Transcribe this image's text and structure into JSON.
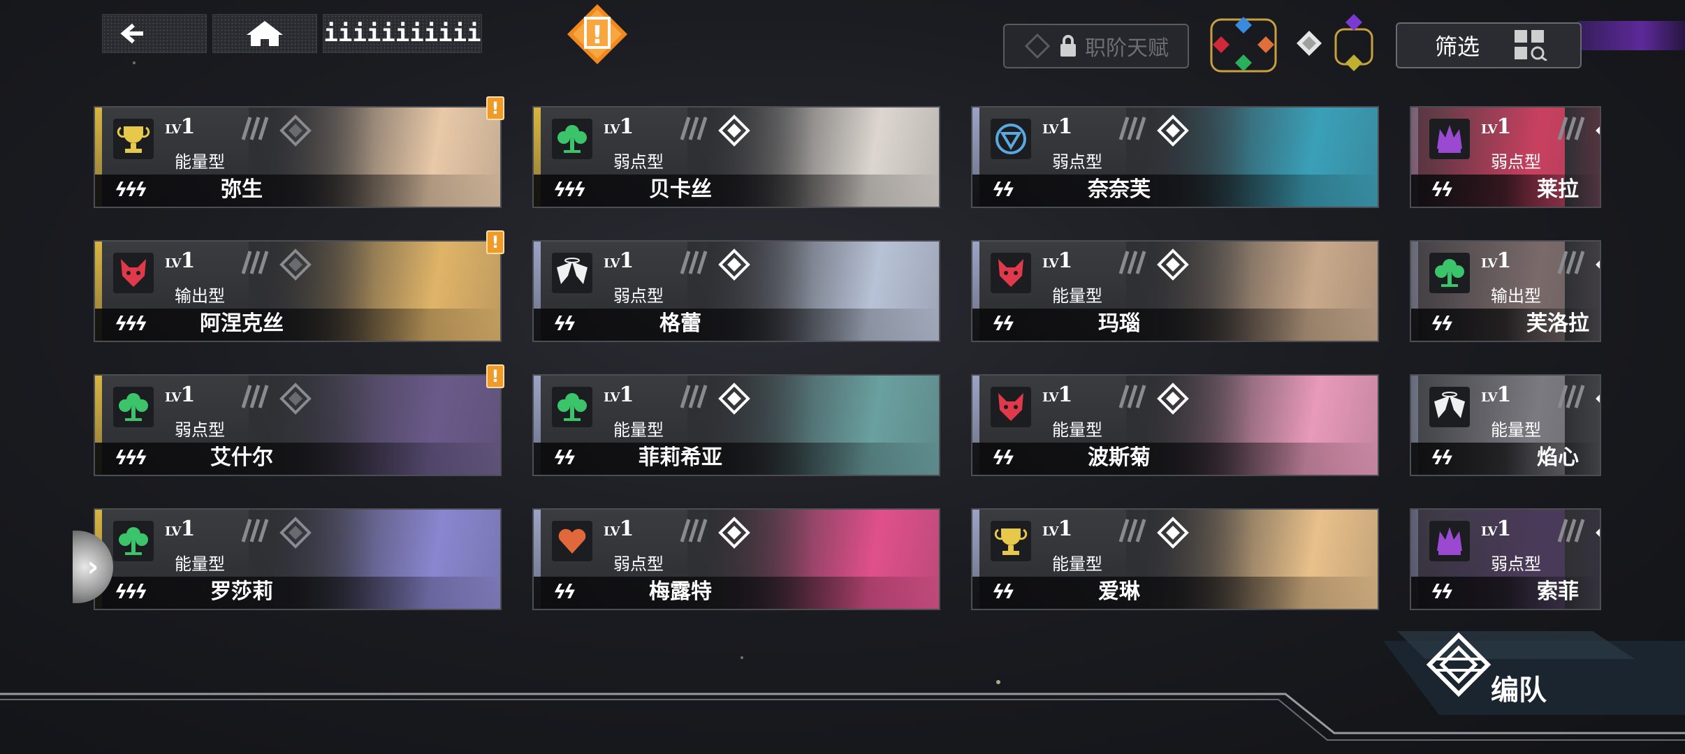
{
  "topbar": {
    "home_label": "",
    "page_tab_label": "iiiiiiiiiii",
    "alert_symbol": "!",
    "talent_label": "职阶天赋",
    "filter_label": "筛选",
    "back_icon": "back-arrow-icon",
    "home_icon": "home-icon"
  },
  "cards": [
    {
      "level_prefix": "LV",
      "level": "1",
      "type": "能量型",
      "name": "弥生",
      "color": "#d8b441",
      "icon": "trophy",
      "stars": "ⅉⅉⅉ",
      "bolts": "ϟϟϟ",
      "badge": "!",
      "portrait": "#e8c9a8"
    },
    {
      "level_prefix": "LV",
      "level": "1",
      "type": "弱点型",
      "name": "贝卡丝",
      "color": "#d8b441",
      "icon": "tree",
      "stars": "",
      "bolts": "ϟϟϟ",
      "badge": "",
      "portrait": "#dcd6cf"
    },
    {
      "level_prefix": "LV",
      "level": "1",
      "type": "弱点型",
      "name": "奈奈芙",
      "color": "#9aa3c4",
      "icon": "shield",
      "stars": "",
      "bolts": "ϟϟ",
      "badge": "",
      "portrait": "#3aa0b8"
    },
    {
      "level_prefix": "LV",
      "level": "1",
      "type": "弱点型",
      "name": "莱拉",
      "color": "#9aa3c4",
      "icon": "crown",
      "stars": "",
      "bolts": "ϟϟ",
      "badge": "",
      "portrait": "#c94060"
    },
    {
      "level_prefix": "LV",
      "level": "1",
      "type": "输出型",
      "name": "阿涅克丝",
      "color": "#d8b441",
      "icon": "wolf",
      "stars": "",
      "bolts": "ϟϟϟ",
      "badge": "!",
      "portrait": "#e0b468"
    },
    {
      "level_prefix": "LV",
      "level": "1",
      "type": "弱点型",
      "name": "格蕾",
      "color": "#9aa3c4",
      "icon": "wings",
      "stars": "",
      "bolts": "ϟϟ",
      "badge": "",
      "portrait": "#b8c2d6"
    },
    {
      "level_prefix": "LV",
      "level": "1",
      "type": "能量型",
      "name": "玛瑙",
      "color": "#9aa3c4",
      "icon": "wolf",
      "stars": "",
      "bolts": "ϟϟ",
      "badge": "",
      "portrait": "#c9a98a"
    },
    {
      "level_prefix": "LV",
      "level": "1",
      "type": "输出型",
      "name": "芙洛拉",
      "color": "#9aa3c4",
      "icon": "tree",
      "stars": "",
      "bolts": "ϟϟ",
      "badge": "",
      "portrait": "#7a6a6a"
    },
    {
      "level_prefix": "LV",
      "level": "1",
      "type": "弱点型",
      "name": "艾什尔",
      "color": "#d8b441",
      "icon": "tree",
      "stars": "",
      "bolts": "ϟϟϟ",
      "badge": "!",
      "portrait": "#6a5a8a"
    },
    {
      "level_prefix": "LV",
      "level": "1",
      "type": "能量型",
      "name": "菲莉希亚",
      "color": "#9aa3c4",
      "icon": "tree",
      "stars": "",
      "bolts": "ϟϟ",
      "badge": "",
      "portrait": "#6aa0a0"
    },
    {
      "level_prefix": "LV",
      "level": "1",
      "type": "能量型",
      "name": "波斯菊",
      "color": "#9aa3c4",
      "icon": "wolf",
      "stars": "",
      "bolts": "ϟϟ",
      "badge": "",
      "portrait": "#e89aba"
    },
    {
      "level_prefix": "LV",
      "level": "1",
      "type": "能量型",
      "name": "焰心",
      "color": "#9aa3c4",
      "icon": "wings",
      "stars": "",
      "bolts": "ϟϟ",
      "badge": "",
      "portrait": "#7a7a80"
    },
    {
      "level_prefix": "LV",
      "level": "1",
      "type": "能量型",
      "name": "罗莎莉",
      "color": "#d8b441",
      "icon": "tree",
      "stars": "",
      "bolts": "ϟϟϟ",
      "badge": "",
      "portrait": "#8a86d0"
    },
    {
      "level_prefix": "LV",
      "level": "1",
      "type": "弱点型",
      "name": "梅露特",
      "color": "#9aa3c4",
      "icon": "heart",
      "stars": "",
      "bolts": "ϟϟ",
      "badge": "",
      "portrait": "#e0508a"
    },
    {
      "level_prefix": "LV",
      "level": "1",
      "type": "能量型",
      "name": "爱琳",
      "color": "#9aa3c4",
      "icon": "trophy",
      "stars": "",
      "bolts": "ϟϟ",
      "badge": "",
      "portrait": "#e8c08a"
    },
    {
      "level_prefix": "LV",
      "level": "1",
      "type": "弱点型",
      "name": "索菲",
      "color": "#9aa3c4",
      "icon": "crown",
      "stars": "",
      "bolts": "ϟϟ",
      "badge": "",
      "portrait": "#4a3a5a"
    }
  ],
  "icon_colors": {
    "trophy": "#e8c84a",
    "tree": "#3cc46a",
    "shield": "#5aa8e0",
    "crown": "#9a4ad0",
    "wolf": "#e03a4a",
    "wings": "#f0f0f0",
    "heart": "#e0683a"
  },
  "team_label": "编队"
}
